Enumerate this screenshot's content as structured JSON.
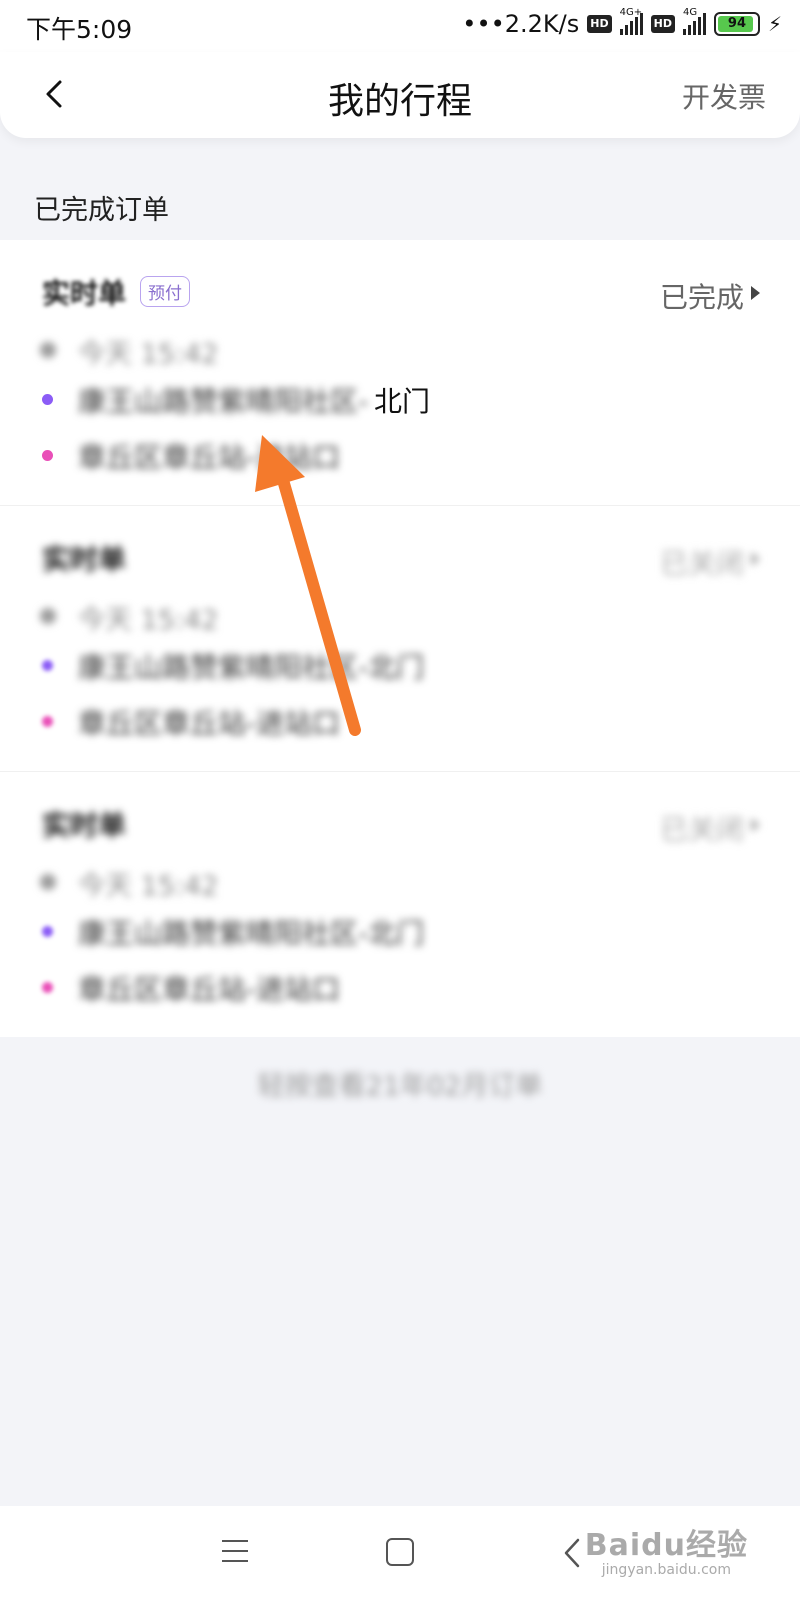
{
  "status_bar": {
    "time": "下午5:09",
    "network_speed": "•••2.2K/s",
    "hd_badge": "HD",
    "signal1_label": "4G+",
    "signal2_label": "4G",
    "battery": "94"
  },
  "header": {
    "title": "我的行程",
    "invoice_label": "开发票"
  },
  "section_title": "已完成订单",
  "orders": [
    {
      "title": "实时单",
      "tag": "预付",
      "status": "已完成",
      "time": "今天 15:42",
      "from": "康王山路赞紫晴阳社区-",
      "from_suffix": "北门",
      "to": "章丘区章丘站-进站口"
    },
    {
      "title": "实时单",
      "status": "已关闭",
      "time": "今天 15:42",
      "from": "康王山路赞紫晴阳社区-北门",
      "to": "章丘区章丘站-进站口"
    },
    {
      "title": "实时单",
      "status": "已关闭",
      "time": "今天 15:42",
      "from": "康王山路赞紫晴阳社区-北门",
      "to": "章丘区章丘站-进站口"
    }
  ],
  "history_link": "轻按查看21年02月订单",
  "watermark": {
    "logo": "Baidu经验",
    "url": "jingyan.baidu.com"
  },
  "colors": {
    "arrow": "#f47a2c",
    "start_dot": "#8b5cf6",
    "end_dot": "#e94fb8",
    "tag": "#8a6fcf",
    "background": "#f3f4f8"
  }
}
